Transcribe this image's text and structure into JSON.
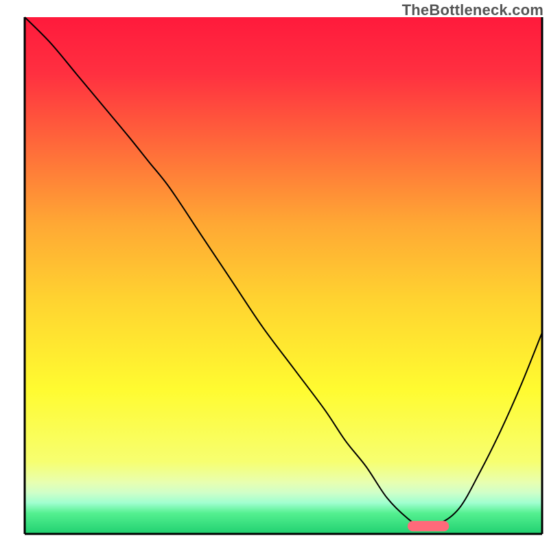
{
  "watermark": "TheBottleneck.com",
  "chart_data": {
    "type": "line",
    "title": "",
    "xlabel": "",
    "ylabel": "",
    "xlim": [
      0,
      100
    ],
    "ylim": [
      0,
      100
    ],
    "grid": false,
    "axes_visible": {
      "left": true,
      "bottom": true,
      "right": true
    },
    "background_gradient": {
      "stops": [
        {
          "offset": 0.0,
          "color": "#ff1a3c"
        },
        {
          "offset": 0.11,
          "color": "#ff3040"
        },
        {
          "offset": 0.25,
          "color": "#ff6a3a"
        },
        {
          "offset": 0.4,
          "color": "#ffa834"
        },
        {
          "offset": 0.55,
          "color": "#ffd430"
        },
        {
          "offset": 0.72,
          "color": "#fffb30"
        },
        {
          "offset": 0.86,
          "color": "#f7ff70"
        },
        {
          "offset": 0.9,
          "color": "#e8ffb0"
        },
        {
          "offset": 0.92,
          "color": "#d0ffc8"
        },
        {
          "offset": 0.94,
          "color": "#a0ffd0"
        },
        {
          "offset": 0.96,
          "color": "#54f090"
        },
        {
          "offset": 1.0,
          "color": "#20d070"
        }
      ]
    },
    "series": [
      {
        "name": "bottleneck-curve",
        "type": "line",
        "color": "#000000",
        "width": 2,
        "x": [
          0,
          5,
          10,
          15,
          20,
          24,
          28,
          34,
          40,
          46,
          52,
          58,
          62,
          66,
          70,
          74,
          76,
          80,
          84,
          88,
          92,
          96,
          100
        ],
        "y": [
          100,
          95,
          89,
          83,
          77,
          72,
          67,
          58,
          49,
          40,
          32,
          24,
          18,
          13,
          7,
          3,
          2,
          2,
          5,
          12,
          20,
          29,
          39
        ]
      }
    ],
    "markers": [
      {
        "name": "optimal-marker",
        "type": "capsule",
        "color": "#ff6a7a",
        "x_center": 78,
        "y_center": 1.5,
        "width": 8,
        "height": 2
      }
    ]
  }
}
